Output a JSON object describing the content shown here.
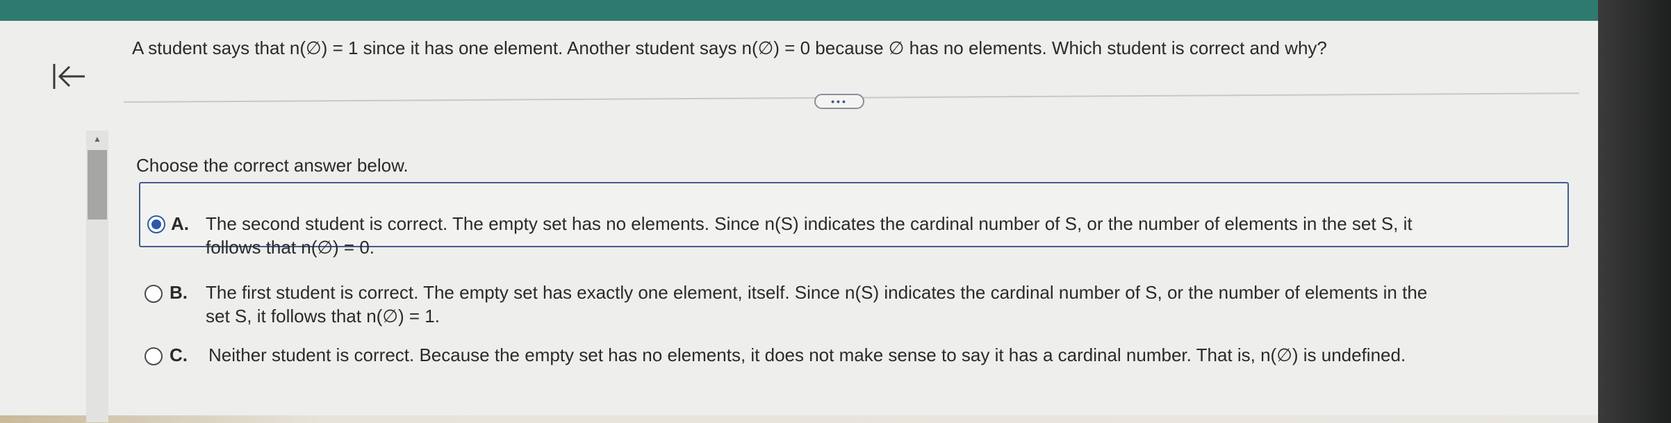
{
  "question": "A student says that n(∅) = 1 since it has one element. Another student says n(∅) = 0 because ∅ has no elements. Which student is correct and why?",
  "more_label": "•••",
  "prompt": "Choose the correct answer below.",
  "options": [
    {
      "letter": "A.",
      "line1": "The second student is correct. The empty set has no elements. Since n(S) indicates the cardinal number of S, or the number of elements in the set S, it",
      "line2": "follows that n(∅) = 0.",
      "selected": true
    },
    {
      "letter": "B.",
      "line1": "The first student is correct. The empty set has exactly one element, itself. Since n(S) indicates the cardinal number of S, or the number of elements in the",
      "line2": "set S, it follows that n(∅) = 1.",
      "selected": false
    },
    {
      "letter": "C.",
      "line1": "Neither student is correct. Because the empty set has no elements, it does not make sense to say it has a cardinal number. That is, n(∅) is undefined.",
      "selected": false
    }
  ],
  "colors": {
    "header": "#2f7a6e",
    "selection_border": "#3f5d8c",
    "radio_selected": "#2b5ba8"
  },
  "icons": {
    "back": "arrow-left-to-bar-icon",
    "scroll_up": "triangle-up-icon"
  }
}
